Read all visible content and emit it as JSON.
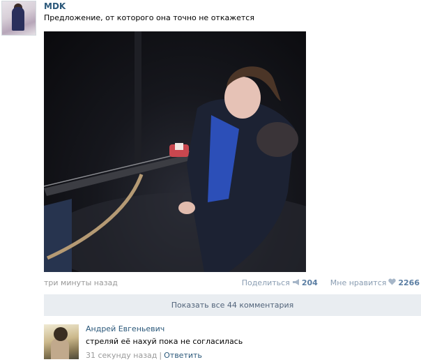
{
  "post": {
    "author": "MDK",
    "text": "Предложение, от которого она точно не откажется",
    "time": "три минуты назад",
    "share_label": "Поделиться",
    "share_count": "204",
    "like_label": "Мне нравится",
    "like_count": "2266",
    "show_comments_label": "Показать все 44 комментария"
  },
  "comment": {
    "author": "Андрей Евгеньевич",
    "text": "стреляй её нахуй пока не согласилась",
    "time": "31 секунду назад",
    "separator": "|",
    "reply_label": "Ответить"
  },
  "colors": {
    "link": "#2b587a",
    "meta": "#999999",
    "action_count": "#5b7ea3",
    "comments_bar": "#e9edf1"
  },
  "icons": {
    "share": "megaphone-icon",
    "like": "heart-icon"
  }
}
